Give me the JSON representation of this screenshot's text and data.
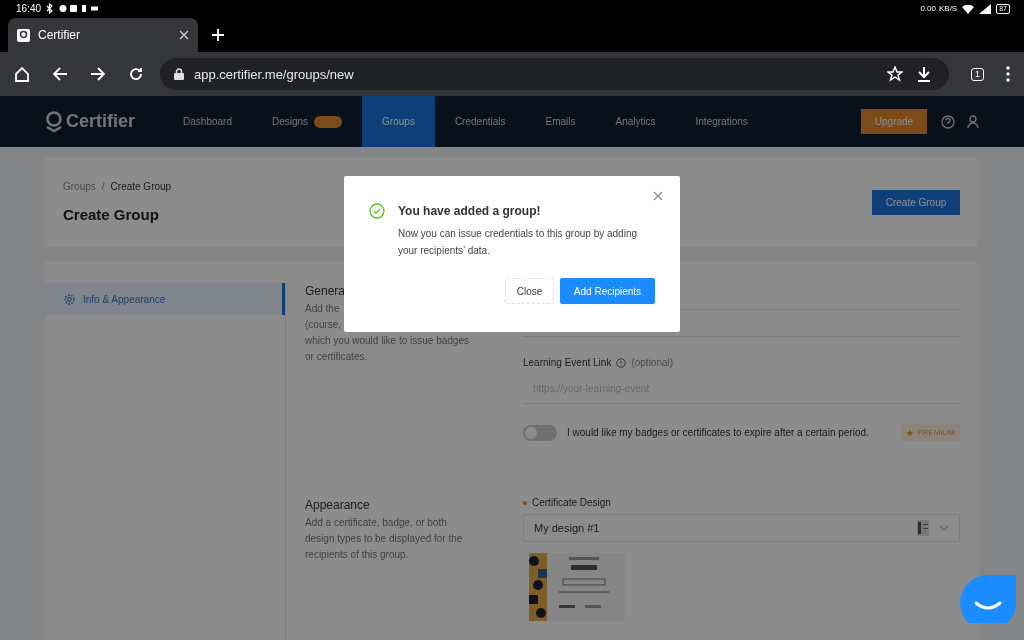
{
  "status_bar": {
    "time": "16:40",
    "net_speed": "0.00",
    "net_unit": "KB/S",
    "battery": "87"
  },
  "browser": {
    "tab_title": "Certifier",
    "url": "app.certifier.me/groups/new",
    "tab_count": "1"
  },
  "app_nav": {
    "logo": "Certifier",
    "items": [
      {
        "label": "Dashboard",
        "selected": false,
        "badge": false
      },
      {
        "label": "Designs",
        "selected": false,
        "badge": true
      },
      {
        "label": "Groups",
        "selected": true,
        "badge": false
      },
      {
        "label": "Credentials",
        "selected": false,
        "badge": false
      },
      {
        "label": "Emails",
        "selected": false,
        "badge": false
      },
      {
        "label": "Analytics",
        "selected": false,
        "badge": false
      },
      {
        "label": "Integrations",
        "selected": false,
        "badge": false
      }
    ],
    "upgrade": "Upgrade"
  },
  "header": {
    "breadcrumb": [
      "Groups",
      "Create Group"
    ],
    "breadcrumb_separator": "/",
    "title": "Create Group",
    "button": "Create Group"
  },
  "sidebar": {
    "items": [
      {
        "label": "Info & Appearance",
        "selected": true
      }
    ]
  },
  "general": {
    "heading": "Genera",
    "description_lines": [
      "Add the",
      "(course,",
      "which you would like to issue badges",
      "or certificates."
    ],
    "fields": [
      {
        "kind": "blank"
      },
      {
        "kind": "blank"
      },
      {
        "kind": "link",
        "label": "Learning Event Link",
        "note": "(optional)",
        "placeholder": "https://your-learning-event"
      }
    ],
    "toggle": {
      "on": false,
      "label": "I would like my badges or certificates to expire after a certain period.",
      "badge": "PREMIUM"
    }
  },
  "appearance": {
    "heading": "Appearance",
    "description": "Add a certificate, badge, or both design types to be displayed for the recipients of this group.",
    "design_label": "Certificate Design",
    "design_value": "My design #1"
  },
  "modal": {
    "title": "You have added a group!",
    "message": "Now you can issue credentials to this group by adding your recipients’ data.",
    "buttons": [
      {
        "label": "Close",
        "kind": "secondary"
      },
      {
        "label": "Add Recipients",
        "kind": "primary"
      }
    ]
  }
}
